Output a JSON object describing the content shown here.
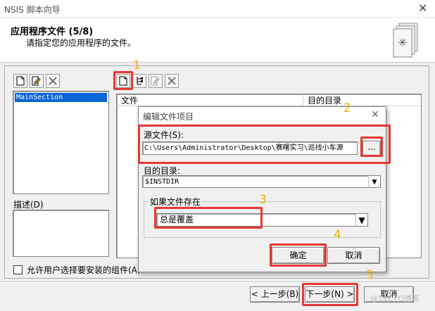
{
  "window": {
    "title": "NSIS 脚本向导"
  },
  "header": {
    "title": "应用程序文件 (5/8)",
    "subtitle": "请指定您的应用程序的文件。"
  },
  "sections": {
    "selected": "MainSection"
  },
  "list_columns": {
    "file": "文件",
    "dest": "目的目录"
  },
  "description_label": "描述(D)",
  "allow_checkbox": {
    "label": "允许用户选择要安装的组件(A)",
    "checked": false
  },
  "footer": {
    "back": "< 上一步(B)",
    "next": "下一步(N) >",
    "cancel": "取消"
  },
  "watermark": "@51CTO博客",
  "dialog": {
    "title": "编辑文件项目",
    "source_label": "源文件(S):",
    "source_value": "C:\\Users\\Administrator\\Desktop\\赛曙实习\\巡线小车源",
    "browse": "...",
    "dest_label": "目的目录:",
    "dest_value": "$INSTDIR",
    "exists_group": "如果文件存在",
    "exists_value": "总是覆盖",
    "ok": "确定",
    "cancel": "取消"
  },
  "annotations": [
    "1",
    "2",
    "3",
    "4",
    "5"
  ],
  "colors": {
    "highlight": "#e53935",
    "annotation": "#f2b400",
    "selection": "#0a64d6"
  }
}
